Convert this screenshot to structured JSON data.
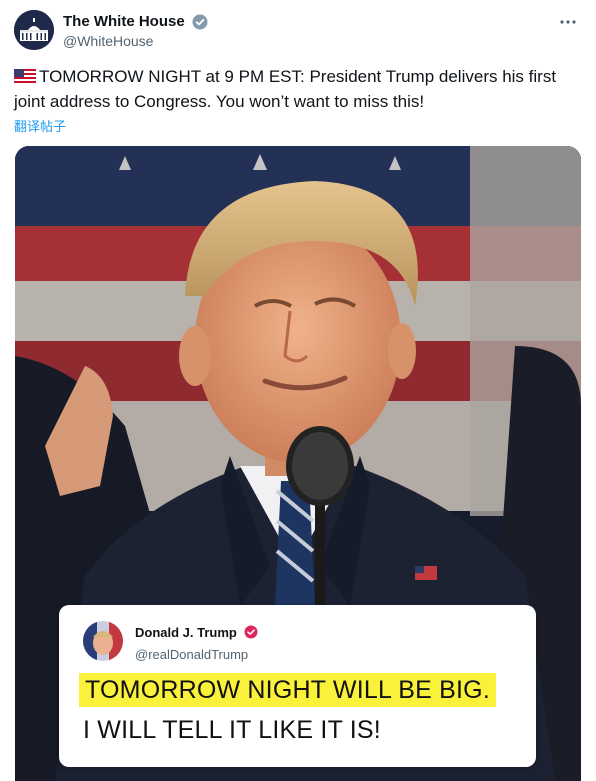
{
  "tweet": {
    "display_name": "The White House",
    "handle": "@WhiteHouse",
    "text": "TOMORROW NIGHT at 9 PM EST: President Trump delivers his first joint address to Congress. You won’t want to miss this!",
    "translate_label": "翻译帖子",
    "flag_icon": "us-flag-icon",
    "more_icon": "more-options-icon"
  },
  "embedded_post": {
    "display_name": "Donald J. Trump",
    "handle": "@realDonaldTrump",
    "line1": "TOMORROW NIGHT WILL BE BIG.",
    "line2": "I WILL TELL IT LIKE IT IS!",
    "highlight_color": "#f9f13a"
  },
  "colors": {
    "verified_blue": "#1d9bf0",
    "verified_pink": "#e0245e",
    "link_blue": "#1d9bf0",
    "text_primary": "#0f1419",
    "text_secondary": "#536471"
  }
}
